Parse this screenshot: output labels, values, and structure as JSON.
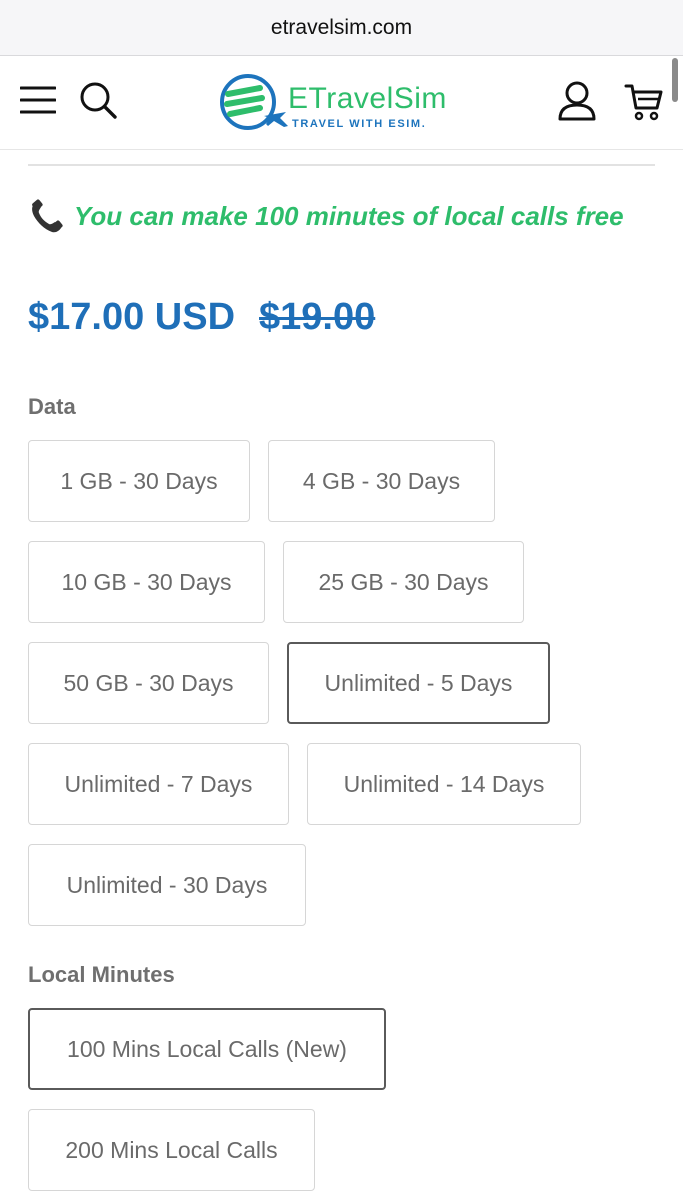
{
  "browser": {
    "url": "etravelsim.com"
  },
  "header": {
    "logo_name": "ETravelSim",
    "logo_tagline": "TRAVEL WITH ESIM.",
    "icons": [
      "menu-icon",
      "search-icon",
      "account-icon",
      "cart-icon"
    ]
  },
  "promo": {
    "icon": "phone-icon",
    "text": "You can make 100 minutes of local calls free"
  },
  "pricing": {
    "price": "$17.00 USD",
    "compare_price": "$19.00"
  },
  "data_options": {
    "label": "Data",
    "selected": "Unlimited - 5 Days",
    "options": [
      "1 GB - 30 Days",
      "4 GB - 30 Days",
      "10 GB - 30 Days",
      "25 GB - 30 Days",
      "50 GB - 30 Days",
      "Unlimited - 5 Days",
      "Unlimited - 7 Days",
      "Unlimited - 14 Days",
      "Unlimited - 30 Days"
    ]
  },
  "minutes_options": {
    "label": "Local Minutes",
    "selected": "100 Mins Local Calls (New)",
    "options": [
      "100 Mins Local Calls (New)",
      "200 Mins Local Calls"
    ]
  },
  "colors": {
    "brand_green": "#2ebd6b",
    "brand_blue": "#1f6fb8",
    "selected_border": "#5a5a5a"
  }
}
